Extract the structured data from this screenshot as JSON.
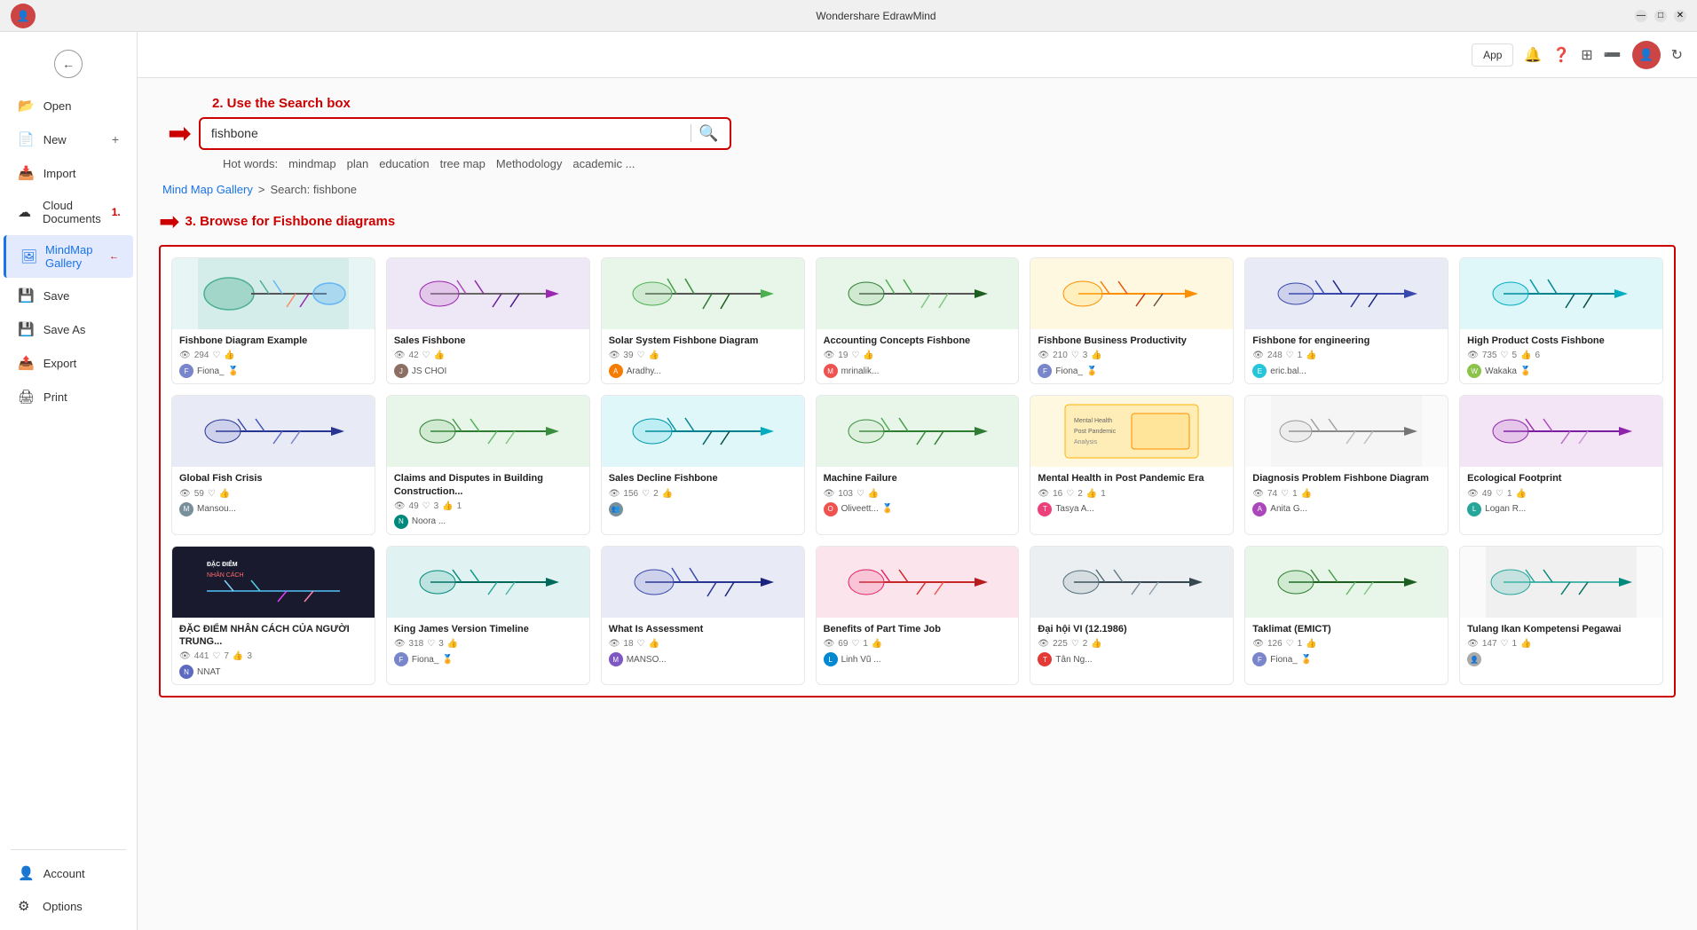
{
  "titlebar": {
    "title": "Wondershare EdrawMind",
    "minimize": "—",
    "maximize": "□",
    "close": "✕"
  },
  "topbar": {
    "app_btn": "App",
    "refresh_icon": "↻"
  },
  "sidebar": {
    "back_icon": "←",
    "items": [
      {
        "id": "open",
        "label": "Open",
        "icon": "📂"
      },
      {
        "id": "new",
        "label": "New",
        "icon": "📄",
        "extra": "+"
      },
      {
        "id": "import",
        "label": "Import",
        "icon": "📥"
      },
      {
        "id": "cloud",
        "label": "Cloud Documents",
        "icon": "☁",
        "badge": "1."
      },
      {
        "id": "gallery",
        "label": "MindMap Gallery",
        "icon": "🖼",
        "active": true
      },
      {
        "id": "save",
        "label": "Save",
        "icon": "💾"
      },
      {
        "id": "saveas",
        "label": "Save As",
        "icon": "💾"
      },
      {
        "id": "export",
        "label": "Export",
        "icon": "📤"
      },
      {
        "id": "print",
        "label": "Print",
        "icon": "🖨"
      }
    ],
    "bottom_items": [
      {
        "id": "account",
        "label": "Account",
        "icon": "👤"
      },
      {
        "id": "options",
        "label": "Options",
        "icon": "⚙"
      }
    ]
  },
  "annotation1": {
    "step": "2. Use the Search box"
  },
  "annotation2": {
    "step": "3. Browse for Fishbone diagrams"
  },
  "search": {
    "value": "fishbone",
    "placeholder": "fishbone",
    "hot_words_label": "Hot words:",
    "hot_words": [
      "mindmap",
      "plan",
      "education",
      "tree map",
      "Methodology",
      "academic ..."
    ]
  },
  "breadcrumb": {
    "link": "Mind Map Gallery",
    "separator": ">",
    "current": "Search: fishbone"
  },
  "gallery": {
    "cards": [
      {
        "title": "Fishbone Diagram Example",
        "views": "294",
        "likes": "",
        "hearts": "",
        "author": "Fiona_",
        "author_badge": "gold",
        "thumb_color": "teal",
        "row": 1
      },
      {
        "title": "Sales Fishbone",
        "views": "42",
        "likes": "",
        "hearts": "",
        "author": "JS CHOI",
        "thumb_color": "purple",
        "row": 1
      },
      {
        "title": "Solar System Fishbone Diagram",
        "views": "39",
        "likes": "",
        "hearts": "",
        "author": "Aradhy...",
        "thumb_color": "green",
        "row": 1
      },
      {
        "title": "Accounting Concepts Fishbone",
        "views": "19",
        "likes": "",
        "hearts": "",
        "author": "mrinalik...",
        "thumb_color": "green",
        "row": 1
      },
      {
        "title": "Fishbone Business Productivity",
        "views": "210",
        "likes": "3",
        "hearts": "",
        "author": "Fiona_",
        "author_badge": "gold",
        "thumb_color": "mixed",
        "row": 1
      },
      {
        "title": "Fishbone for engineering",
        "views": "248",
        "likes": "1",
        "hearts": "",
        "author": "eric.bal...",
        "thumb_color": "blue",
        "row": 1
      },
      {
        "title": "High Product Costs Fishbone",
        "views": "735",
        "likes": "5",
        "hearts": "6",
        "author": "Wakaka",
        "author_badge": "gold",
        "thumb_color": "teal",
        "row": 1
      },
      {
        "title": "Global Fish Crisis",
        "views": "59",
        "likes": "",
        "hearts": "",
        "author": "Mansou...",
        "thumb_color": "navy",
        "row": 2
      },
      {
        "title": "Claims and Disputes in Building Construction...",
        "views": "49",
        "likes": "3",
        "hearts": "1",
        "author": "Noora ...",
        "thumb_color": "green",
        "row": 2
      },
      {
        "title": "Sales Decline Fishbone",
        "views": "156",
        "likes": "2",
        "hearts": "",
        "author": "👥",
        "thumb_color": "teal",
        "row": 2
      },
      {
        "title": "Machine Failure",
        "views": "103",
        "likes": "",
        "hearts": "",
        "author": "Oliveett...",
        "author_badge": "gold",
        "thumb_color": "green",
        "row": 2
      },
      {
        "title": "Mental Health in Post Pandemic Era",
        "views": "16",
        "likes": "2",
        "hearts": "1",
        "author": "Tasya A...",
        "thumb_color": "amber",
        "row": 2
      },
      {
        "title": "Diagnosis Problem Fishbone Diagram",
        "views": "74",
        "likes": "1",
        "hearts": "",
        "author": "Anita G...",
        "thumb_color": "mixed",
        "row": 2
      },
      {
        "title": "Ecological Footprint",
        "views": "49",
        "likes": "1",
        "hearts": "",
        "author": "Logan R...",
        "thumb_color": "purple",
        "row": 2
      },
      {
        "title": "ĐẶC ĐIỂM NHÂN CÁCH CỦA NGƯỜI TRUNG...",
        "views": "441",
        "likes": "7",
        "hearts": "3",
        "author": "NNAT",
        "thumb_color": "dark",
        "row": 3
      },
      {
        "title": "King James Version Timeline",
        "views": "318",
        "likes": "3",
        "hearts": "",
        "author": "Fiona_",
        "author_badge": "gold",
        "thumb_color": "teal",
        "row": 3
      },
      {
        "title": "What Is Assessment",
        "views": "18",
        "likes": "",
        "hearts": "",
        "author": "MANSO...",
        "thumb_color": "blue",
        "row": 3
      },
      {
        "title": "Benefits of Part Time Job",
        "views": "69",
        "likes": "1",
        "hearts": "",
        "author": "Linh Vũ ...",
        "thumb_color": "coral",
        "row": 3
      },
      {
        "title": "Đại hội VI (12.1986)",
        "views": "225",
        "likes": "2",
        "hearts": "",
        "author": "Tân Ng...",
        "thumb_color": "navy",
        "row": 3
      },
      {
        "title": "Taklimat (EMICT)",
        "views": "126",
        "likes": "1",
        "hearts": "",
        "author": "Fiona_",
        "author_badge": "gold",
        "thumb_color": "green",
        "row": 3
      },
      {
        "title": "Tulang Ikan Kompetensi Pegawai",
        "views": "147",
        "likes": "1",
        "hearts": "",
        "author": "👤",
        "thumb_color": "mixed",
        "row": 3
      }
    ]
  }
}
